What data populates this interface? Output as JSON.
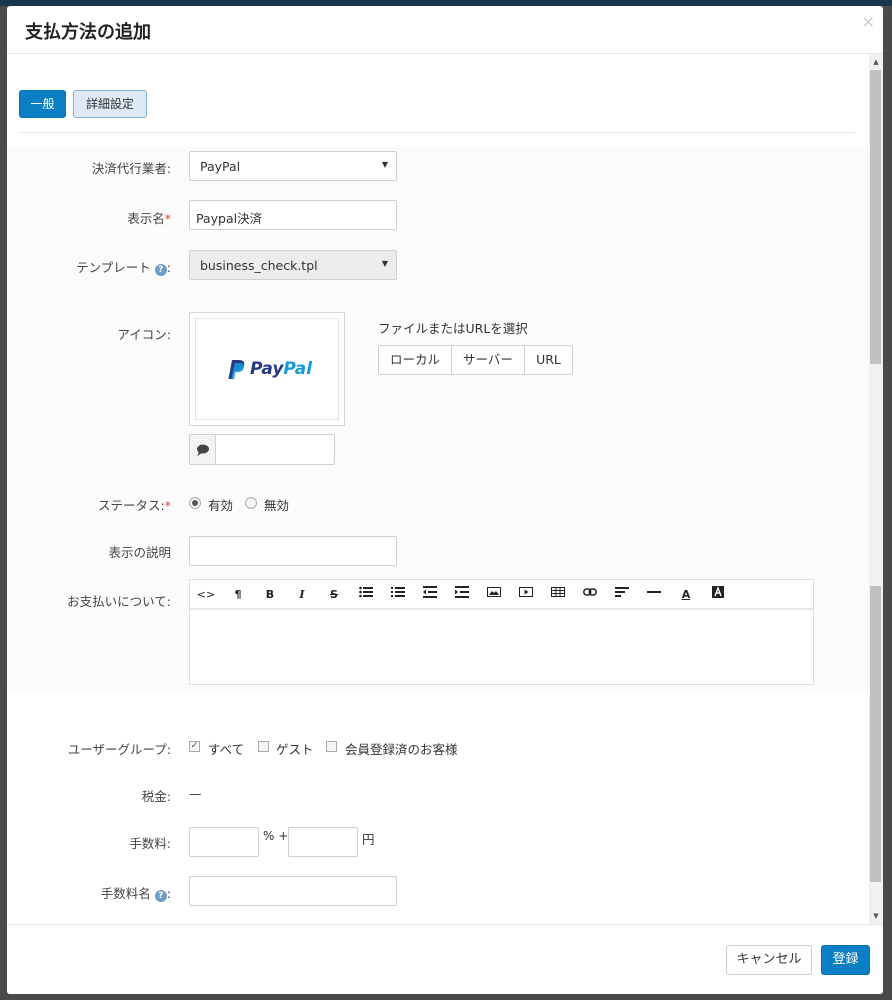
{
  "modal": {
    "title": "支払方法の追加",
    "close_glyph": "×"
  },
  "tabs": [
    {
      "label": "一般"
    },
    {
      "label": "詳細設定"
    }
  ],
  "form": {
    "processor": {
      "label": "決済代行業者:",
      "value": "PayPal"
    },
    "display_name": {
      "label": "表示名",
      "required_mark": "*",
      "value": "Paypal決済"
    },
    "template": {
      "label": "テンプレート",
      "suffix": ":",
      "value": "business_check.tpl",
      "disabled": true
    },
    "icon": {
      "label": "アイコン:",
      "logo_text_1": "Pay",
      "logo_text_2": "Pal",
      "file_select_label": "ファイルまたはURLを選択",
      "buttons": [
        "ローカル",
        "サーバー",
        "URL"
      ],
      "alt_value": ""
    },
    "status": {
      "label": "ステータス:",
      "required_mark": "*",
      "options": [
        "有効",
        "無効"
      ],
      "selected": "有効"
    },
    "description": {
      "label": "表示の説明",
      "value": ""
    },
    "payment_about": {
      "label": "お支払いについて:",
      "value": ""
    },
    "user_group": {
      "label": "ユーザーグループ:",
      "options": [
        "すべて",
        "ゲスト",
        "会員登録済のお客様"
      ],
      "checked": [
        "すべて"
      ]
    },
    "tax": {
      "label": "税金:",
      "value": "—"
    },
    "fee": {
      "label": "手数料:",
      "percent_value": "",
      "percent_sep": "% +",
      "fixed_value": "",
      "currency": "円"
    },
    "fee_name": {
      "label": "手数料名",
      "suffix": ":",
      "value": ""
    }
  },
  "footer": {
    "cancel_label": "キャンセル",
    "submit_label": "登録"
  },
  "colors": {
    "primary": "#0b7fc4",
    "required": "#e0453a",
    "help_icon": "#6f9cc9"
  }
}
